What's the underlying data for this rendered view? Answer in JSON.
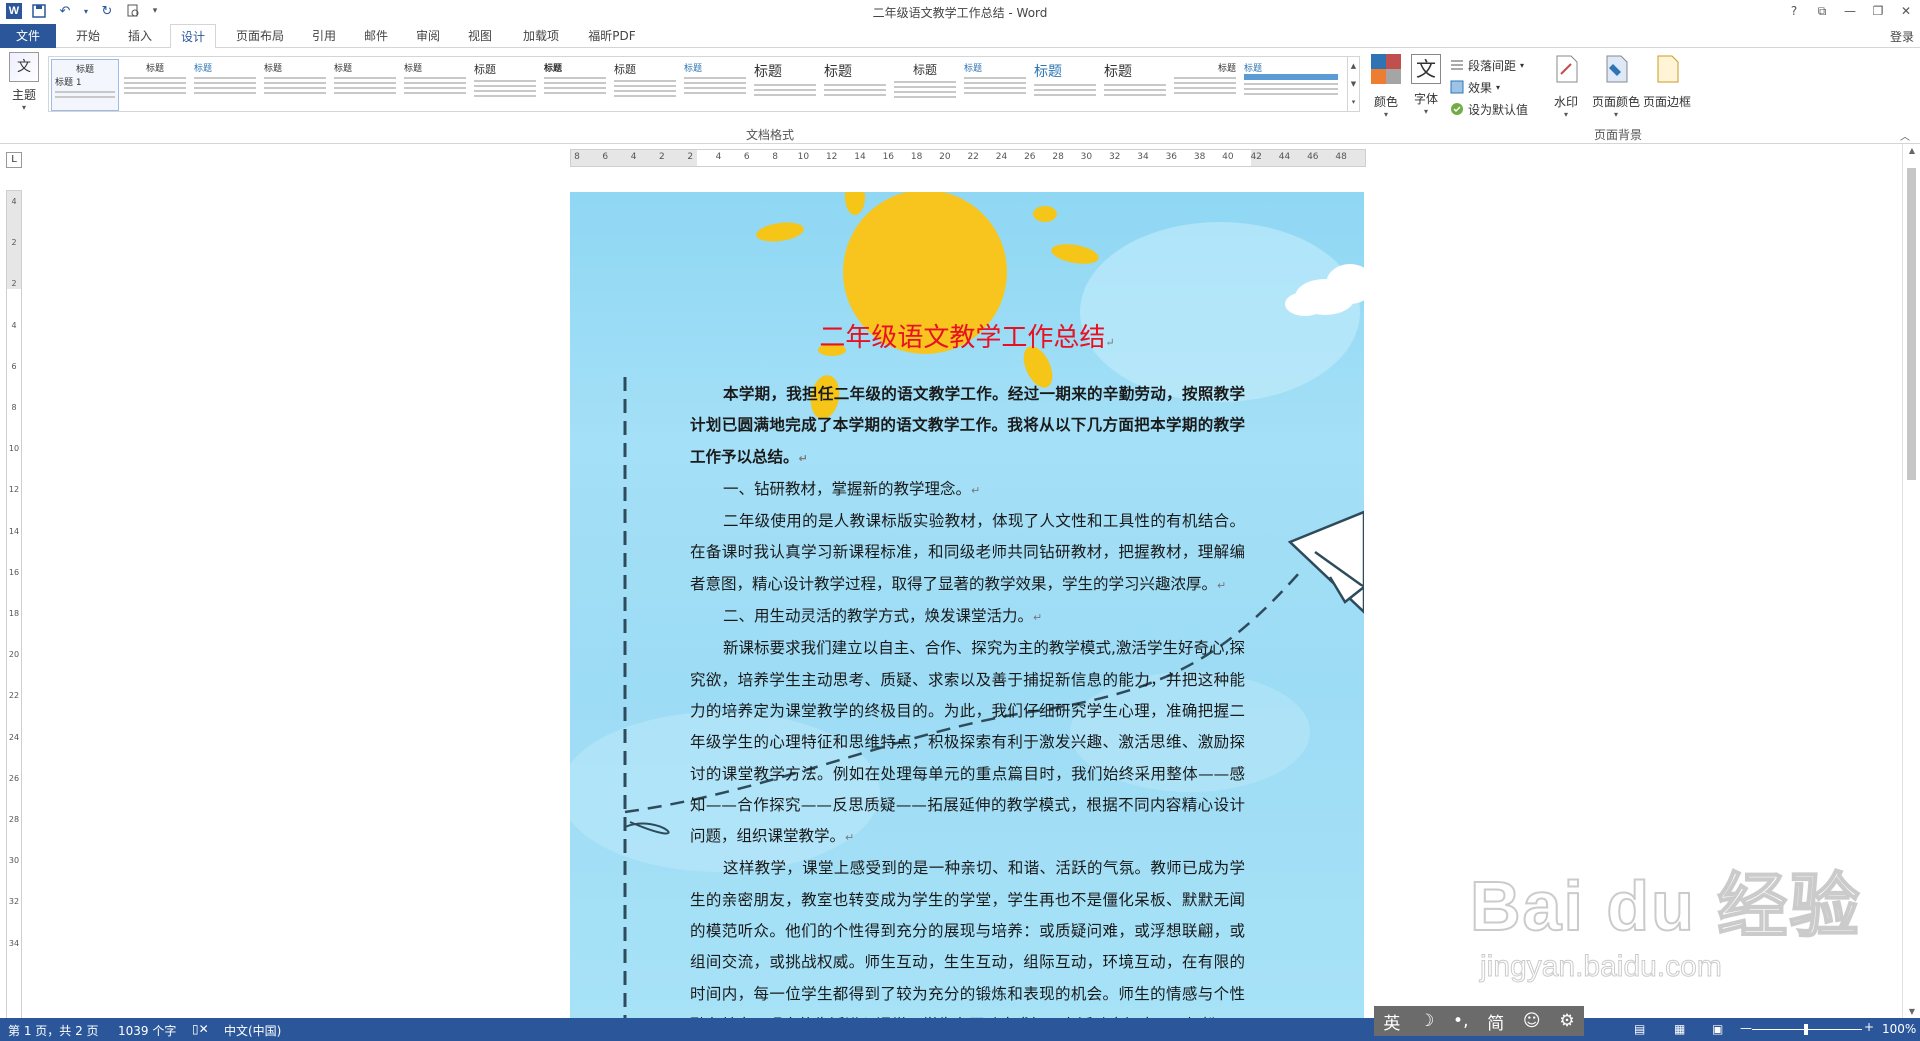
{
  "window": {
    "title": "二年级语文教学工作总结 - Word",
    "controls": [
      "?",
      "⧉",
      "—",
      "❐",
      "✕"
    ],
    "login": "登录"
  },
  "tabs": [
    "文件",
    "开始",
    "插入",
    "设计",
    "页面布局",
    "引用",
    "邮件",
    "审阅",
    "视图",
    "加载项",
    "福昕PDF"
  ],
  "ribbon": {
    "theme_label": "主题",
    "theme_icon_text": "文",
    "gallery_group_label": "文档格式",
    "gallery_items": [
      {
        "title": "标题 1",
        "heading": "标题"
      },
      {
        "title": "标题",
        "heading": "标题"
      },
      {
        "title": "标题",
        "heading": "标题"
      },
      {
        "title": "标题",
        "heading": "标题"
      },
      {
        "title": "标题",
        "heading": "标题"
      },
      {
        "title": "标题",
        "heading": "标题"
      },
      {
        "title": "标题",
        "heading": "标题"
      },
      {
        "title": "标题",
        "heading": "标题"
      },
      {
        "title": "标题",
        "heading": "标题"
      },
      {
        "title": "标题",
        "heading": "标题"
      },
      {
        "title": "标题",
        "heading": "标题"
      },
      {
        "title": "标题",
        "heading": "标题"
      },
      {
        "title": "标题",
        "heading": "标题"
      },
      {
        "title": "标题",
        "heading": "标题"
      },
      {
        "title": "标题",
        "heading": "标题"
      },
      {
        "title": "标题",
        "heading": "标题"
      },
      {
        "title": "标题",
        "heading": "标题"
      },
      {
        "title": "标题",
        "heading": "标题"
      }
    ],
    "colors_label": "颜色",
    "fonts_label": "字体",
    "fonts_icon_text": "文",
    "paragraph_spacing_label": "段落间距",
    "effects_label": "效果",
    "set_default_label": "设为默认值",
    "watermark_label": "水印",
    "page_color_label": "页面颜色",
    "page_borders_label": "页面边框",
    "page_background_group_label": "页面背景"
  },
  "ruler": {
    "corner": "L",
    "h_numbers": [
      "8",
      "6",
      "4",
      "2",
      "2",
      "4",
      "6",
      "8",
      "10",
      "12",
      "14",
      "16",
      "18",
      "20",
      "22",
      "24",
      "26",
      "28",
      "30",
      "32",
      "34",
      "36",
      "38",
      "40",
      "42",
      "44",
      "46",
      "48"
    ],
    "v_numbers": [
      "4",
      "2",
      "2",
      "4",
      "6",
      "8",
      "10",
      "12",
      "14",
      "16",
      "18",
      "20",
      "22",
      "24",
      "26",
      "28",
      "30",
      "32",
      "34"
    ]
  },
  "document": {
    "heading": "二年级语文教学工作总结",
    "paragraphs": [
      {
        "text": "本学期，我担任二年级的语文教学工作。经过一期来的辛勤劳动，按照教学计划已圆满地完成了本学期的语文教学工作。我将从以下几方面把本学期的教学工作予以总结。",
        "bold": true
      },
      {
        "text": "一、钻研教材，掌握新的教学理念。",
        "bold": false
      },
      {
        "text": "二年级使用的是人教课标版实验教材，体现了人文性和工具性的有机结合。在备课时我认真学习新课程标准，和同级老师共同钻研教材，把握教材，理解编者意图，精心设计教学过程，取得了显著的教学效果，学生的学习兴趣浓厚。",
        "bold": false
      },
      {
        "text": "二、用生动灵活的教学方式，焕发课堂活力。",
        "bold": false
      },
      {
        "text": "新课标要求我们建立以自主、合作、探究为主的教学模式,激活学生好奇心,探究欲，培养学生主动思考、质疑、求索以及善于捕捉新信息的能力，并把这种能力的培养定为课堂教学的终极目的。为此，我们仔细研究学生心理，准确把握二年级学生的心理特征和思维特点，积极探索有利于激发兴趣、激活思维、激励探讨的课堂教学方法。例如在处理每单元的重点篇目时，我们始终采用整体——感知——合作探究——反思质疑——拓展延伸的教学模式，根据不同内容精心设计问题，组织课堂教学。",
        "bold": false
      },
      {
        "text": "这样教学，课堂上感受到的是一种亲切、和谐、活跃的气氛。教师已成为学生的亲密朋友，教室也转变成为学生的学堂，学生再也不是僵化呆板、默默无闻的模范听众。他们的个性得到充分的展现与培养：或质疑问难，或浮想联翩，或组间交流，或挑战权威。师生互动，生生互动，组际互动，环境互动，在有限的时间内，每一位学生都得到了较为充分的锻炼和表现的机会。师生的情感与个性融在其中，现实的生活进入课堂，学生在互动中求知，在活动中探索，既轻松",
        "bold": false
      }
    ],
    "pilcrow": "↵",
    "bg_colors": {
      "sky": "#9ddcf5",
      "sun": "#f5c518",
      "heading": "#e81123"
    }
  },
  "status": {
    "page": "第 1 页，共 2 页",
    "words": "1039 个字",
    "language": "中文(中国)",
    "zoom": "100%",
    "zoom_minus": "—",
    "zoom_plus": "+"
  },
  "ime": {
    "items": [
      "英",
      "☽",
      "•,",
      "简",
      "☺",
      "⚙"
    ]
  },
  "watermark": {
    "main": "Bai du 经验",
    "sub": "jingyan.baidu.com"
  }
}
